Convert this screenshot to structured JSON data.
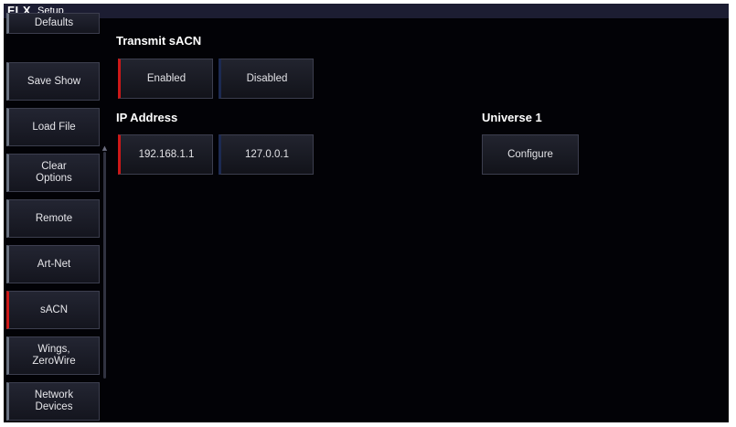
{
  "window": {
    "brand": "FLX",
    "title": "Setup"
  },
  "sidebar": {
    "items": [
      {
        "label": "Defaults",
        "active": false
      },
      {
        "label": "Save Show",
        "active": false
      },
      {
        "label": "Load File",
        "active": false
      },
      {
        "label": "Clear\nOptions",
        "active": false
      },
      {
        "label": "Remote",
        "active": false
      },
      {
        "label": "Art-Net",
        "active": false
      },
      {
        "label": "sACN",
        "active": true
      },
      {
        "label": "Wings,\nZeroWire",
        "active": false
      },
      {
        "label": "Network\nDevices",
        "active": false
      }
    ]
  },
  "transmit": {
    "label": "Transmit sACN",
    "options": [
      {
        "label": "Enabled",
        "selected": true
      },
      {
        "label": "Disabled",
        "selected": false
      }
    ]
  },
  "ip": {
    "label": "IP Address",
    "options": [
      {
        "label": "192.168.1.1",
        "selected": true
      },
      {
        "label": "127.0.0.1",
        "selected": false
      }
    ]
  },
  "universe": {
    "label": "Universe 1",
    "configure_label": "Configure"
  },
  "colors": {
    "background": "#020206",
    "titlebar": "#1c1d32",
    "selected_marker": "#cc1818",
    "unselected_marker": "#1c2a52"
  }
}
